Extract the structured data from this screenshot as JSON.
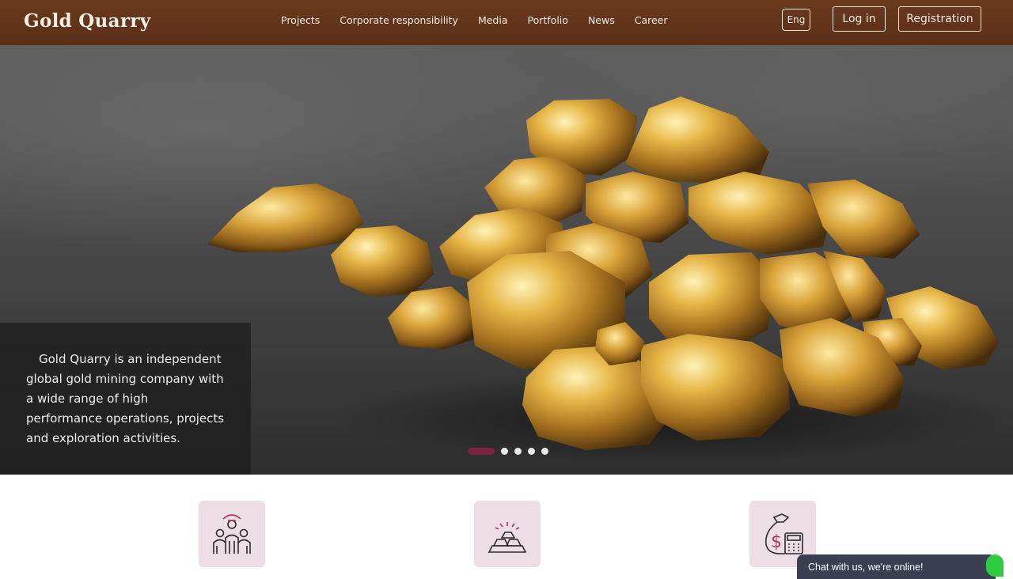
{
  "header": {
    "logo": "Gold Quarry",
    "nav": [
      "Projects",
      "Corporate responsibility",
      "Media",
      "Portfolio",
      "News",
      "Career"
    ],
    "language": "Eng",
    "login_label": "Log in",
    "register_label": "Registration"
  },
  "hero": {
    "intro": "Gold Quarry is an independent global gold mining company with a wide range of high performance operations, projects and exploration activities.",
    "slides_total": 5,
    "active_slide": 1
  },
  "features": [
    {
      "icon": "team-icon"
    },
    {
      "icon": "gold-bars-icon"
    },
    {
      "icon": "money-calculator-icon"
    }
  ],
  "chat": {
    "label": "Chat with us, we're online!"
  },
  "colors": {
    "header_bg": "#5f331a",
    "accent": "#7a2440",
    "tile_bg": "#ecdee4",
    "chat_bg": "#3b3f52",
    "online": "#2ecc40"
  }
}
